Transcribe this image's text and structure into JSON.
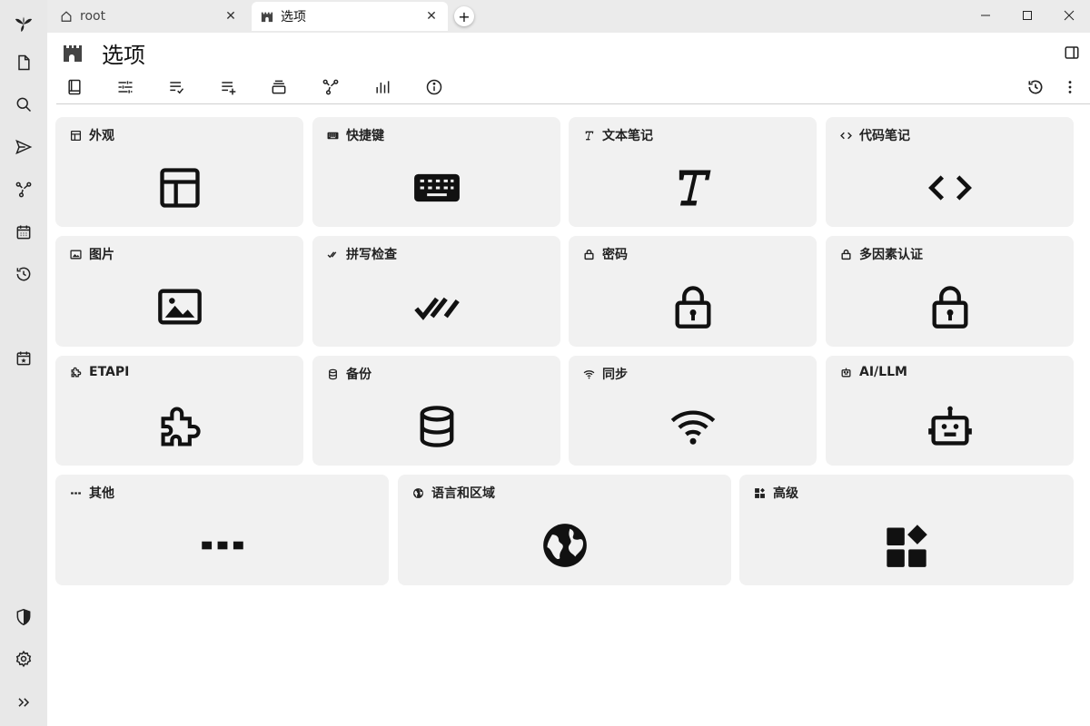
{
  "tabs": [
    {
      "title": "root",
      "icon": "home-icon",
      "active": false
    },
    {
      "title": "选项",
      "icon": "castle-icon",
      "active": true
    }
  ],
  "page": {
    "title": "选项"
  },
  "cards": [
    {
      "key": "appearance",
      "label": "外观",
      "icon": "layout-icon"
    },
    {
      "key": "shortcuts",
      "label": "快捷键",
      "icon": "keyboard-icon"
    },
    {
      "key": "text_notes",
      "label": "文本笔记",
      "icon": "italic-t-icon"
    },
    {
      "key": "code_notes",
      "label": "代码笔记",
      "icon": "code-icon"
    },
    {
      "key": "images",
      "label": "图片",
      "icon": "image-icon"
    },
    {
      "key": "spellcheck",
      "label": "拼写检查",
      "icon": "double-check-icon"
    },
    {
      "key": "password",
      "label": "密码",
      "icon": "lock-icon"
    },
    {
      "key": "mfa",
      "label": "多因素认证",
      "icon": "lock-icon"
    },
    {
      "key": "etapi",
      "label": "ETAPI",
      "icon": "puzzle-icon"
    },
    {
      "key": "backup",
      "label": "备份",
      "icon": "database-icon"
    },
    {
      "key": "sync",
      "label": "同步",
      "icon": "wifi-icon"
    },
    {
      "key": "ai",
      "label": "AI/LLM",
      "icon": "robot-icon"
    },
    {
      "key": "other",
      "label": "其他",
      "icon": "dots-icon"
    },
    {
      "key": "i18n",
      "label": "语言和区域",
      "icon": "globe-icon"
    },
    {
      "key": "advanced",
      "label": "高级",
      "icon": "widgets-icon"
    }
  ]
}
